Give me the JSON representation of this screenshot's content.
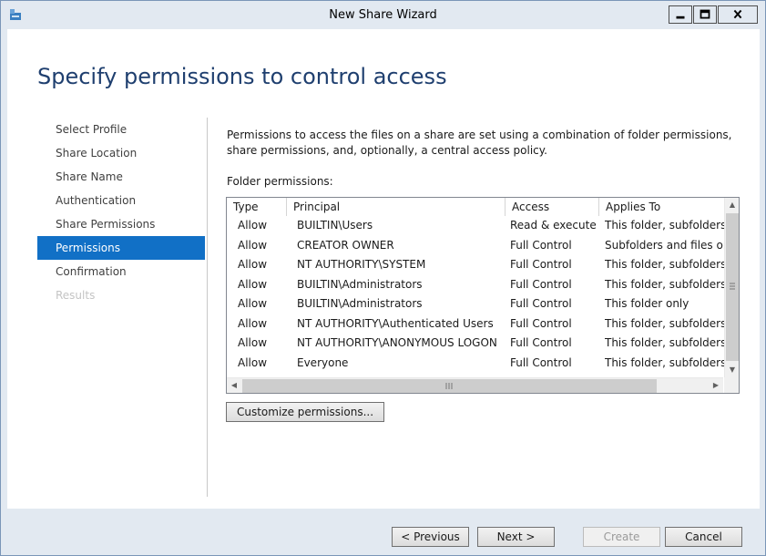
{
  "window": {
    "title": "New Share Wizard",
    "min_icon": "minimize-icon",
    "max_icon": "maximize-icon",
    "close_icon": "close-icon",
    "accent": "#1170c6"
  },
  "page": {
    "heading": "Specify permissions to control access",
    "description": "Permissions to access the files on a share are set using a combination of folder permissions, share permissions, and, optionally, a central access policy.",
    "folder_permissions_label": "Folder permissions:"
  },
  "nav": {
    "items": [
      {
        "label": "Select Profile",
        "state": "normal"
      },
      {
        "label": "Share Location",
        "state": "normal"
      },
      {
        "label": "Share Name",
        "state": "normal"
      },
      {
        "label": "Authentication",
        "state": "normal"
      },
      {
        "label": "Share Permissions",
        "state": "normal"
      },
      {
        "label": "Permissions",
        "state": "selected"
      },
      {
        "label": "Confirmation",
        "state": "normal"
      },
      {
        "label": "Results",
        "state": "disabled"
      }
    ]
  },
  "table": {
    "headers": {
      "type": "Type",
      "principal": "Principal",
      "access": "Access",
      "applies": "Applies To"
    },
    "rows": [
      {
        "type": "Allow",
        "principal": "BUILTIN\\Users",
        "access": "Read & execute",
        "applies": "This folder, subfolders,"
      },
      {
        "type": "Allow",
        "principal": "CREATOR OWNER",
        "access": "Full Control",
        "applies": "Subfolders and files on"
      },
      {
        "type": "Allow",
        "principal": "NT AUTHORITY\\SYSTEM",
        "access": "Full Control",
        "applies": "This folder, subfolders,"
      },
      {
        "type": "Allow",
        "principal": "BUILTIN\\Administrators",
        "access": "Full Control",
        "applies": "This folder, subfolders,"
      },
      {
        "type": "Allow",
        "principal": "BUILTIN\\Administrators",
        "access": "Full Control",
        "applies": "This folder only"
      },
      {
        "type": "Allow",
        "principal": "NT AUTHORITY\\Authenticated Users",
        "access": "Full Control",
        "applies": "This folder, subfolders,"
      },
      {
        "type": "Allow",
        "principal": "NT AUTHORITY\\ANONYMOUS LOGON",
        "access": "Full Control",
        "applies": "This folder, subfolders,"
      },
      {
        "type": "Allow",
        "principal": "Everyone",
        "access": "Full Control",
        "applies": "This folder, subfolders,"
      }
    ]
  },
  "buttons": {
    "customize": "Customize permissions...",
    "previous": "< Previous",
    "next": "Next >",
    "create": "Create",
    "cancel": "Cancel"
  }
}
